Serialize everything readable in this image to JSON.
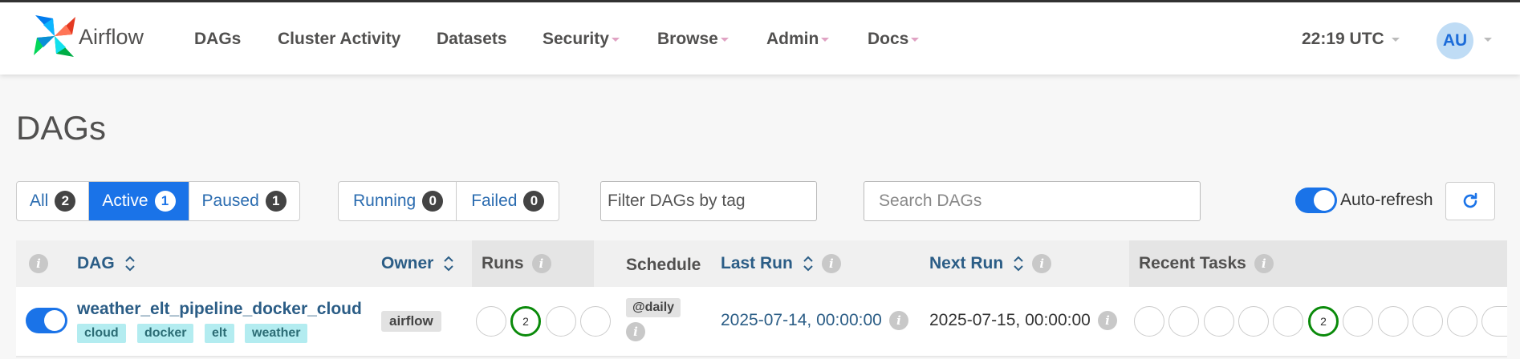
{
  "colors": {
    "primary": "#1a73e8",
    "link": "#2b5d86",
    "success": "#0a8a0a",
    "tag_bg": "#b3ecf0",
    "badge": "#444444"
  },
  "navbar": {
    "brand": "Airflow",
    "logo_icon": "airflow-pinwheel-icon",
    "items": [
      "DAGs",
      "Cluster Activity",
      "Datasets",
      "Security",
      "Browse",
      "Admin",
      "Docs"
    ],
    "clock": "22:19 UTC",
    "avatar": "AU"
  },
  "page": {
    "title": "DAGs"
  },
  "filters": {
    "status": [
      {
        "label": "All",
        "count": "2"
      },
      {
        "label": "Active",
        "count": "1",
        "active": true
      },
      {
        "label": "Paused",
        "count": "1"
      }
    ],
    "runs": [
      {
        "label": "Running",
        "count": "0"
      },
      {
        "label": "Failed",
        "count": "0"
      }
    ],
    "tag_filter_value": "Filter DAGs by tag",
    "search_placeholder": "Search DAGs",
    "auto_refresh_label": "Auto-refresh",
    "auto_refresh_on": true,
    "refresh_icon": "refresh-icon"
  },
  "table": {
    "headers": {
      "dag": "DAG",
      "owner": "Owner",
      "runs": "Runs",
      "schedule": "Schedule",
      "last_run": "Last Run",
      "next_run": "Next Run",
      "recent_tasks": "Recent Tasks"
    },
    "rows": [
      {
        "enabled": true,
        "dag_id": "weather_elt_pipeline_docker_cloud",
        "tags": [
          "cloud",
          "docker",
          "elt",
          "weather"
        ],
        "owner": "airflow",
        "runs": [
          "",
          "2",
          "",
          ""
        ],
        "schedule": "@daily",
        "last_run": "2025-07-14, 00:00:00",
        "next_run": "2025-07-15, 00:00:00",
        "recent_tasks": [
          "",
          "",
          "",
          "",
          "",
          "2",
          "",
          "",
          "",
          "",
          ""
        ]
      }
    ]
  }
}
